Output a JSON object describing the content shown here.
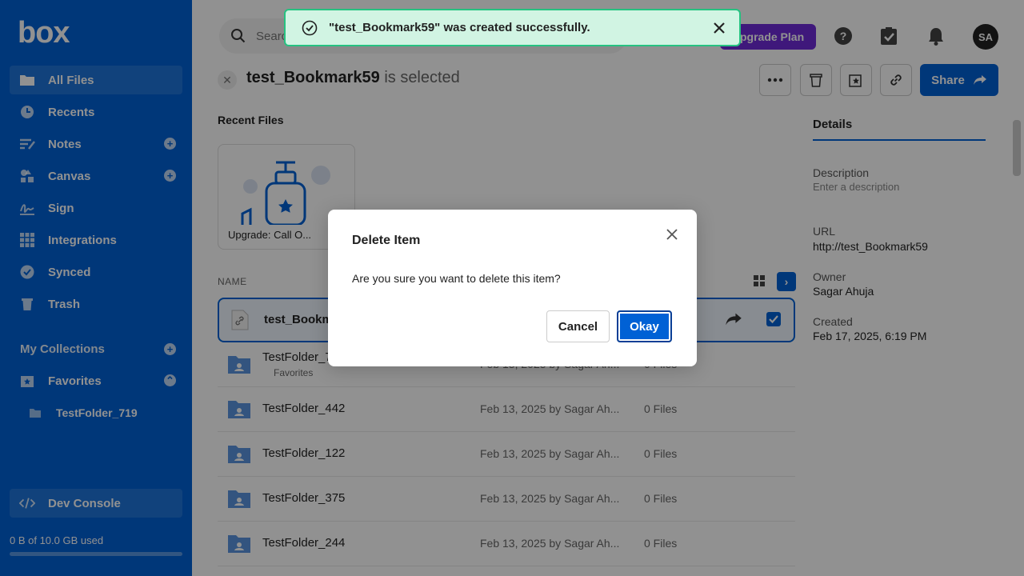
{
  "app": {
    "logo": "box"
  },
  "sidebar": {
    "items": [
      {
        "label": "All Files",
        "icon": "folder-icon"
      },
      {
        "label": "Recents",
        "icon": "clock-icon"
      },
      {
        "label": "Notes",
        "icon": "notes-icon"
      },
      {
        "label": "Canvas",
        "icon": "canvas-icon"
      },
      {
        "label": "Sign",
        "icon": "signature-icon"
      },
      {
        "label": "Integrations",
        "icon": "grid-icon"
      },
      {
        "label": "Synced",
        "icon": "check-circle-icon"
      },
      {
        "label": "Trash",
        "icon": "trash-icon"
      }
    ],
    "collections_label": "My Collections",
    "favorites_label": "Favorites",
    "favorite_item": "TestFolder_719",
    "dev_console": "Dev Console",
    "storage": "0 B of 10.0 GB used",
    "storage_fraction": 0
  },
  "header": {
    "search_placeholder": "Search",
    "upgrade": "Upgrade Plan",
    "avatar": "SA"
  },
  "selection": {
    "name": "test_Bookmark59",
    "suffix": "is selected",
    "share": "Share"
  },
  "recent": {
    "label": "Recent Files",
    "card_label": "Upgrade: Call O..."
  },
  "list": {
    "column_name": "NAME",
    "rows": [
      {
        "name": "test_Bookma",
        "sub": "",
        "date": "",
        "files": ""
      },
      {
        "name": "TestFolder_7",
        "sub": "Favorites",
        "date": "Feb 13, 2025 by Sagar Ah...",
        "files": "0 Files"
      },
      {
        "name": "TestFolder_442",
        "sub": "",
        "date": "Feb 13, 2025 by Sagar Ah...",
        "files": "0 Files"
      },
      {
        "name": "TestFolder_122",
        "sub": "",
        "date": "Feb 13, 2025 by Sagar Ah...",
        "files": "0 Files"
      },
      {
        "name": "TestFolder_375",
        "sub": "",
        "date": "Feb 13, 2025 by Sagar Ah...",
        "files": "0 Files"
      },
      {
        "name": "TestFolder_244",
        "sub": "",
        "date": "Feb 13, 2025 by Sagar Ah...",
        "files": "0 Files"
      }
    ]
  },
  "details": {
    "tab": "Details",
    "description_label": "Description",
    "description_placeholder": "Enter a description",
    "url_label": "URL",
    "url_value": "http://test_Bookmark59",
    "owner_label": "Owner",
    "owner_value": "Sagar Ahuja",
    "created_label": "Created",
    "created_value": "Feb 17, 2025, 6:19 PM"
  },
  "toast": {
    "message": "\"test_Bookmark59\" was created successfully."
  },
  "modal": {
    "title": "Delete Item",
    "body": "Are you sure you want to delete this item?",
    "cancel": "Cancel",
    "okay": "Okay"
  },
  "colors": {
    "brand": "#0061d5",
    "toast_bg": "#d1f4e3",
    "toast_border": "#26c281",
    "upgrade": "#6f2bd9"
  }
}
